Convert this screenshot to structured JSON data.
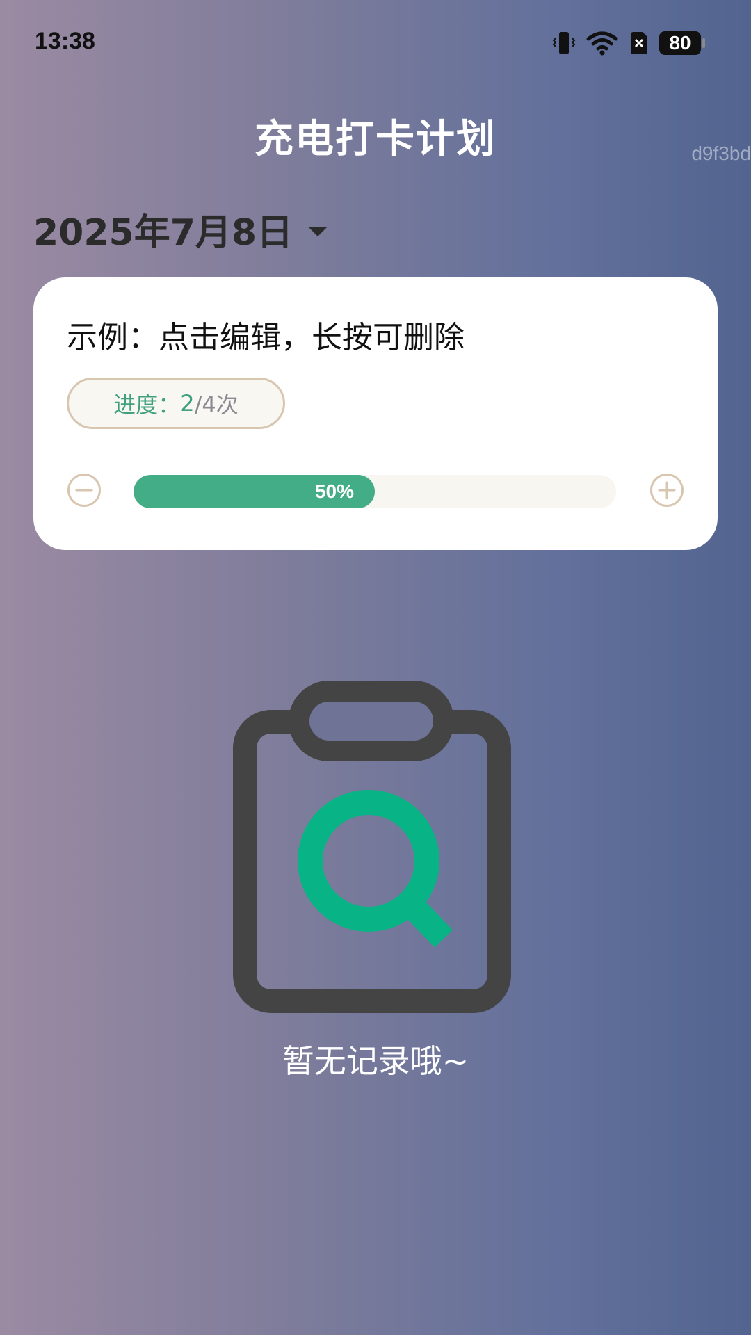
{
  "status_bar": {
    "time": "13:38",
    "battery": "80",
    "icons": [
      "vibrate-icon",
      "wifi-icon",
      "sim-off-icon",
      "battery-icon"
    ]
  },
  "watermark": "d9f3bd",
  "header": {
    "title": "充电打卡计划"
  },
  "date_selector": {
    "date": "2025年7月8日",
    "icon": "caret-down-icon"
  },
  "card": {
    "title": "示例：点击编辑，长按可删除",
    "progress_label": "进度：",
    "progress_done": "2",
    "progress_total": "/4次",
    "progress_fraction": 0.5,
    "progress_percent_text": "50%",
    "minus_icon": "minus-circle-icon",
    "plus_icon": "plus-circle-icon"
  },
  "empty_state": {
    "icon": "clipboard-search-icon",
    "text": "暂无记录哦~"
  },
  "colors": {
    "accent_green": "#43ad87",
    "title_white": "#ffffff",
    "pill_border": "#d8c6b0",
    "card_bg": "#ffffff"
  }
}
